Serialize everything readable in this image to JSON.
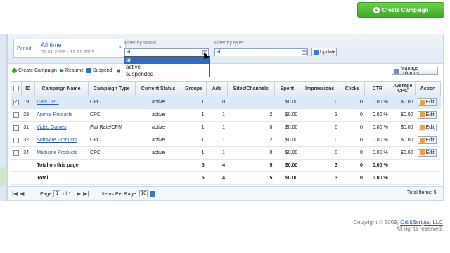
{
  "header": {
    "create_label": "Create Campaign"
  },
  "filters": {
    "period_label": "Period:",
    "period_value": "All time",
    "period_range": "01.01.2008 - 12.21.2009",
    "status_label": "Filter by status:",
    "status_value": "all",
    "status_options": [
      "all",
      "active",
      "suspended"
    ],
    "type_label": "Filter by type:",
    "type_value": "all",
    "update_label": "Update"
  },
  "toolbar": {
    "create": "Create Campaign",
    "resume": "Resume",
    "suspend": "Suspend",
    "manage": "Manage columns"
  },
  "table": {
    "columns": [
      "ID",
      "Campaign Name",
      "Campaign Type",
      "Current Status",
      "Groups",
      "Ads",
      "Sites/Channels",
      "Spent",
      "Impressions",
      "Clicks",
      "CTR",
      "Average CPC",
      "Action"
    ],
    "rows": [
      {
        "checked": true,
        "id": "19",
        "name": "Cars CPC",
        "type": "CPC",
        "status": "active",
        "groups": "1",
        "ads": "0",
        "sites": "1",
        "spent": "$0.00",
        "impr": "0",
        "clicks": "0",
        "ctr": "0.00 %",
        "cpc": "$0.00",
        "edit": "Edit"
      },
      {
        "checked": false,
        "id": "23",
        "name": "Animal Products",
        "type": "CPC",
        "status": "active",
        "groups": "1",
        "ads": "1",
        "sites": "2",
        "spent": "$0.00",
        "impr": "3",
        "clicks": "0",
        "ctr": "0.00 %",
        "cpc": "$0.00",
        "edit": "Edit"
      },
      {
        "checked": false,
        "id": "31",
        "name": "Video Games",
        "type": "Flat Rate/CPM",
        "status": "active",
        "groups": "1",
        "ads": "1",
        "sites": "0",
        "spent": "$0.00",
        "impr": "0",
        "clicks": "0",
        "ctr": "0.00 %",
        "cpc": "$0.00",
        "edit": "Edit"
      },
      {
        "checked": false,
        "id": "32",
        "name": "Software Products",
        "type": "CPC",
        "status": "active",
        "groups": "1",
        "ads": "1",
        "sites": "2",
        "spent": "$0.00",
        "impr": "0",
        "clicks": "0",
        "ctr": "0.00 %",
        "cpc": "$0.00",
        "edit": "Edit"
      },
      {
        "checked": false,
        "id": "34",
        "name": "Medicine Products",
        "type": "CPC",
        "status": "active",
        "groups": "1",
        "ads": "1",
        "sites": "0",
        "spent": "$0.00",
        "impr": "0",
        "clicks": "0",
        "ctr": "0.00 %",
        "cpc": "$0.00",
        "edit": "Edit"
      }
    ],
    "page_total": {
      "label": "Total on this page",
      "groups": "5",
      "ads": "4",
      "sites": "5",
      "spent": "$0.00",
      "impr": "3",
      "clicks": "0",
      "ctr": "0.00 %"
    },
    "total": {
      "label": "Total",
      "groups": "5",
      "ads": "4",
      "sites": "5",
      "spent": "$0.00",
      "impr": "3",
      "clicks": "0",
      "ctr": "0.00 %"
    }
  },
  "pager": {
    "page_label": "Page",
    "page": "1",
    "of_label": "of 1",
    "items_label": "Items Per Page:",
    "items": "10",
    "total_items": "Total Items: 5"
  },
  "footer": {
    "copyright_prefix": "Copyright © 2009,",
    "company": "OrbitScripts, LLC",
    "rights": "All rights reserved."
  }
}
